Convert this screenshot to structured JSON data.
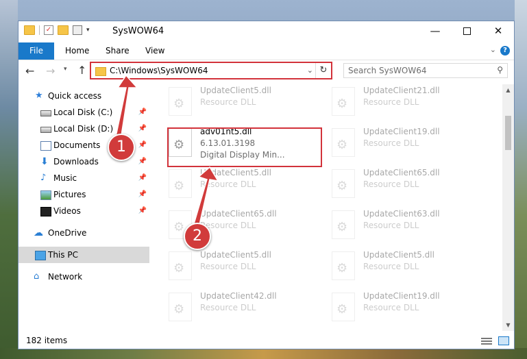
{
  "window": {
    "title": "SysWOW64"
  },
  "ribbon": {
    "tabs": [
      "File",
      "Home",
      "Share",
      "View"
    ]
  },
  "address": {
    "path": "C:\\Windows\\SysWOW64"
  },
  "search": {
    "placeholder": "Search SysWOW64"
  },
  "sidebar": {
    "items": [
      {
        "label": "Quick access",
        "icon": "star-icon"
      },
      {
        "label": "Local Disk (C:)",
        "icon": "drive-icon",
        "pinned": true
      },
      {
        "label": "Local Disk (D:)",
        "icon": "drive-icon",
        "pinned": true
      },
      {
        "label": "Documents",
        "icon": "documents-icon",
        "pinned": true
      },
      {
        "label": "Downloads",
        "icon": "download-icon",
        "pinned": true
      },
      {
        "label": "Music",
        "icon": "music-icon",
        "pinned": true
      },
      {
        "label": "Pictures",
        "icon": "pictures-icon",
        "pinned": true
      },
      {
        "label": "Videos",
        "icon": "videos-icon",
        "pinned": true
      },
      {
        "label": "OneDrive",
        "icon": "cloud-icon"
      },
      {
        "label": "This PC",
        "icon": "computer-icon",
        "selected": true
      },
      {
        "label": "Network",
        "icon": "network-icon"
      }
    ]
  },
  "files": [
    {
      "name": "UpdateClient5.dll",
      "type": "Resource DLL"
    },
    {
      "name": "UpdateClient21.dll",
      "type": "Resource DLL"
    },
    {
      "name": "adv01nt5.dll",
      "version": "6.13.01.3198",
      "description": "Digital Display Min..."
    },
    {
      "name": "UpdateClient19.dll",
      "type": "Resource DLL"
    },
    {
      "name": "UpdateClient5.dll",
      "type": "Resource DLL"
    },
    {
      "name": "UpdateClient65.dll",
      "type": "Resource DLL"
    },
    {
      "name": "UpdateClient65.dll",
      "type": "Resource DLL"
    },
    {
      "name": "UpdateClient63.dll",
      "type": "Resource DLL"
    },
    {
      "name": "UpdateClient5.dll",
      "type": "Resource DLL"
    },
    {
      "name": "UpdateClient5.dll",
      "type": "Resource DLL"
    },
    {
      "name": "UpdateClient42.dll",
      "type": "Resource DLL"
    },
    {
      "name": "UpdateClient19.dll",
      "type": "Resource DLL"
    }
  ],
  "status": {
    "count": "182 items"
  },
  "callouts": [
    "1",
    "2"
  ],
  "colors": {
    "accent": "#1979ca",
    "highlight": "#d2323a"
  }
}
